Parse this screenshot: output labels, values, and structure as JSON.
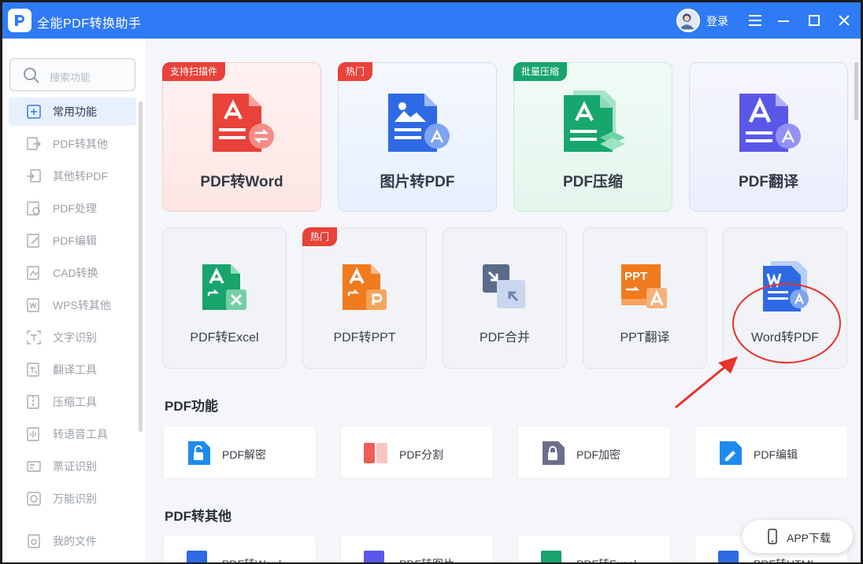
{
  "window": {
    "title": "全能PDF转换助手",
    "login": "登录"
  },
  "sidebar": {
    "search_placeholder": "搜索功能",
    "items": [
      {
        "label": "常用功能",
        "icon": "star-tool-icon"
      },
      {
        "label": "PDF转其他",
        "icon": "pdf-convert-icon"
      },
      {
        "label": "其他转PDF",
        "icon": "to-pdf-icon"
      },
      {
        "label": "PDF处理",
        "icon": "pdf-process-icon"
      },
      {
        "label": "PDF编辑",
        "icon": "pdf-edit-icon"
      },
      {
        "label": "CAD转换",
        "icon": "cad-icon"
      },
      {
        "label": "WPS转其他",
        "icon": "wps-icon"
      },
      {
        "label": "文字识别",
        "icon": "ocr-icon"
      },
      {
        "label": "翻译工具",
        "icon": "translate-icon"
      },
      {
        "label": "压缩工具",
        "icon": "compress-icon"
      },
      {
        "label": "转语音工具",
        "icon": "voice-icon"
      },
      {
        "label": "票证识别",
        "icon": "ticket-icon"
      },
      {
        "label": "万能识别",
        "icon": "scan-icon"
      },
      {
        "label": "我的文件",
        "icon": "file-icon"
      }
    ]
  },
  "featured": [
    {
      "label": "PDF转Word",
      "tag": "支持扫描件",
      "theme": "red"
    },
    {
      "label": "图片转PDF",
      "tag": "热门",
      "theme": "blue"
    },
    {
      "label": "PDF压缩",
      "tag": "批量压缩",
      "theme": "green"
    },
    {
      "label": "PDF翻译",
      "tag": "",
      "theme": "purple"
    }
  ],
  "tools": [
    {
      "label": "PDF转Excel",
      "tag": ""
    },
    {
      "label": "PDF转PPT",
      "tag": "热门"
    },
    {
      "label": "PDF合并",
      "tag": ""
    },
    {
      "label": "PPT翻译",
      "tag": ""
    },
    {
      "label": "Word转PDF",
      "tag": ""
    }
  ],
  "sections": {
    "pdf_functions": {
      "title": "PDF功能",
      "items": [
        "PDF解密",
        "PDF分割",
        "PDF加密",
        "PDF编辑"
      ]
    },
    "pdf_to_other": {
      "title": "PDF转其他",
      "items": [
        "PDF转Word",
        "PDF转图片",
        "PDF转Excel",
        "PDF转HTML"
      ]
    }
  },
  "app_download": "APP下载",
  "icon_text": {
    "ppt": "PPT"
  },
  "colors": {
    "titlebar": "#2f7bf5",
    "accent_red": "#e8423a",
    "accent_green": "#17a46d",
    "annotation": "#e8322c"
  }
}
